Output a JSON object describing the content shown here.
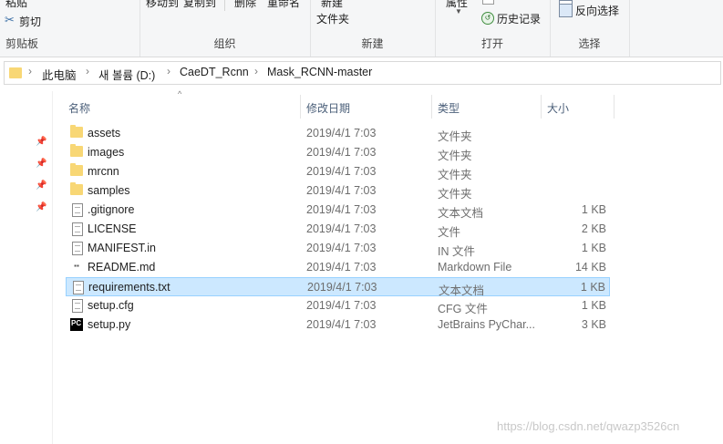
{
  "ribbon": {
    "clipboard": {
      "paste_label": "粘贴",
      "cut_label": "剪切",
      "group_name": "剪贴板"
    },
    "organize": {
      "move_to_label": "移动到",
      "copy_to_label": "复制到",
      "delete_label": "删除",
      "rename_label": "重命名",
      "group_name": "组织"
    },
    "new": {
      "new_folder_line1": "新建",
      "new_folder_line2": "文件夹",
      "group_name": "新建"
    },
    "open": {
      "properties_label": "属性",
      "history_label": "历史记录",
      "group_name": "打开"
    },
    "select": {
      "invert_label": "反向选择",
      "group_name": "选择"
    }
  },
  "address_bar": {
    "crumbs": [
      "此电脑",
      "새 볼륨 (D:)",
      "CaeDT_Rcnn",
      "Mask_RCNN-master"
    ]
  },
  "columns": {
    "name": "名称",
    "date": "修改日期",
    "type": "类型",
    "size": "大小"
  },
  "files": [
    {
      "name": "assets",
      "date": "2019/4/1 7:03",
      "type": "文件夹",
      "size": "",
      "icon": "folder-icon"
    },
    {
      "name": "images",
      "date": "2019/4/1 7:03",
      "type": "文件夹",
      "size": "",
      "icon": "folder-icon"
    },
    {
      "name": "mrcnn",
      "date": "2019/4/1 7:03",
      "type": "文件夹",
      "size": "",
      "icon": "folder-icon"
    },
    {
      "name": "samples",
      "date": "2019/4/1 7:03",
      "type": "文件夹",
      "size": "",
      "icon": "folder-icon"
    },
    {
      "name": ".gitignore",
      "date": "2019/4/1 7:03",
      "type": "文本文档",
      "size": "1 KB",
      "icon": "text-file-icon"
    },
    {
      "name": "LICENSE",
      "date": "2019/4/1 7:03",
      "type": "文件",
      "size": "2 KB",
      "icon": "file-icon"
    },
    {
      "name": "MANIFEST.in",
      "date": "2019/4/1 7:03",
      "type": "IN 文件",
      "size": "1 KB",
      "icon": "file-icon"
    },
    {
      "name": "README.md",
      "date": "2019/4/1 7:03",
      "type": "Markdown File",
      "size": "14 KB",
      "icon": "markdown-file-icon"
    },
    {
      "name": "requirements.txt",
      "date": "2019/4/1 7:03",
      "type": "文本文档",
      "size": "1 KB",
      "icon": "text-file-icon"
    },
    {
      "name": "setup.cfg",
      "date": "2019/4/1 7:03",
      "type": "CFG 文件",
      "size": "1 KB",
      "icon": "file-icon"
    },
    {
      "name": "setup.py",
      "date": "2019/4/1 7:03",
      "type": "JetBrains PyChar...",
      "size": "3 KB",
      "icon": "pycharm-file-icon"
    }
  ],
  "selected_file": "requirements.txt",
  "watermark": "https://blog.csdn.net/qwazp3526cn",
  "colors": {
    "selection_bg": "#cce8ff",
    "selection_border": "#99d1ff",
    "folder": "#f8d775",
    "header_text": "#4c607a"
  }
}
